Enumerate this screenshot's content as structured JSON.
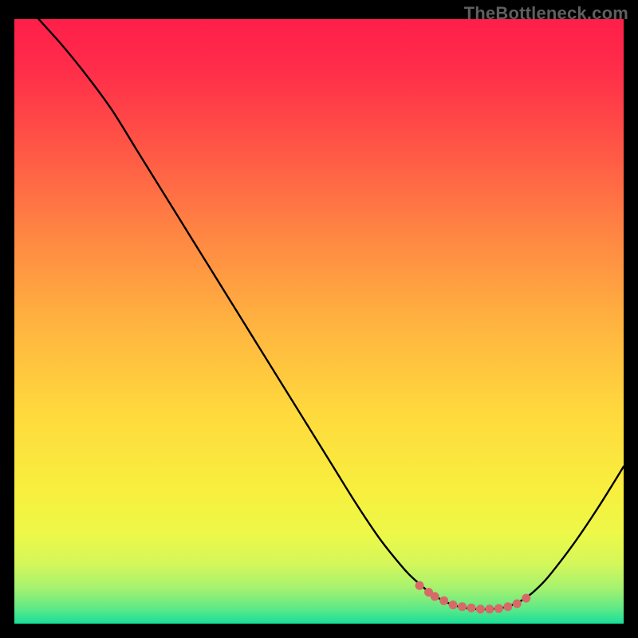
{
  "watermark": "TheBottleneck.com",
  "chart_data": {
    "type": "line",
    "title": "",
    "xlabel": "",
    "ylabel": "",
    "xlim": [
      0,
      100
    ],
    "ylim": [
      0,
      100
    ],
    "grid": false,
    "legend": false,
    "background_gradient": {
      "stops": [
        {
          "offset": 0.0,
          "color": "#ff1f4a"
        },
        {
          "offset": 0.08,
          "color": "#ff2c4a"
        },
        {
          "offset": 0.2,
          "color": "#ff5246"
        },
        {
          "offset": 0.35,
          "color": "#ff8443"
        },
        {
          "offset": 0.5,
          "color": "#ffb240"
        },
        {
          "offset": 0.65,
          "color": "#ffd93d"
        },
        {
          "offset": 0.78,
          "color": "#f8ef3e"
        },
        {
          "offset": 0.85,
          "color": "#edf848"
        },
        {
          "offset": 0.9,
          "color": "#d5f75a"
        },
        {
          "offset": 0.94,
          "color": "#a7f26e"
        },
        {
          "offset": 0.975,
          "color": "#5fe987"
        },
        {
          "offset": 1.0,
          "color": "#17df9a"
        }
      ]
    },
    "series": [
      {
        "name": "bottleneck-curve",
        "x": [
          4,
          8,
          12,
          16,
          20,
          24,
          28,
          32,
          36,
          40,
          44,
          48,
          52,
          56,
          60,
          64,
          66,
          68,
          70,
          72,
          74,
          76,
          78,
          80,
          82,
          84,
          86,
          88,
          92,
          96,
          100
        ],
        "y": [
          100,
          95.5,
          90.5,
          85,
          78.5,
          72,
          65.5,
          59,
          52.5,
          46,
          39.5,
          33,
          26.5,
          20,
          14,
          9,
          7,
          5.3,
          4,
          3.1,
          2.6,
          2.4,
          2.4,
          2.6,
          3.2,
          4.3,
          6.0,
          8.2,
          13.5,
          19.5,
          26
        ]
      }
    ],
    "highlight_points": {
      "name": "min-band",
      "color": "#d76a69",
      "x": [
        66.5,
        68,
        69,
        70.5,
        72,
        73.5,
        75,
        76.5,
        78,
        79.5,
        81,
        82.5,
        84
      ],
      "y": [
        6.3,
        5.2,
        4.5,
        3.8,
        3.1,
        2.8,
        2.6,
        2.4,
        2.4,
        2.5,
        2.8,
        3.3,
        4.2
      ]
    }
  }
}
